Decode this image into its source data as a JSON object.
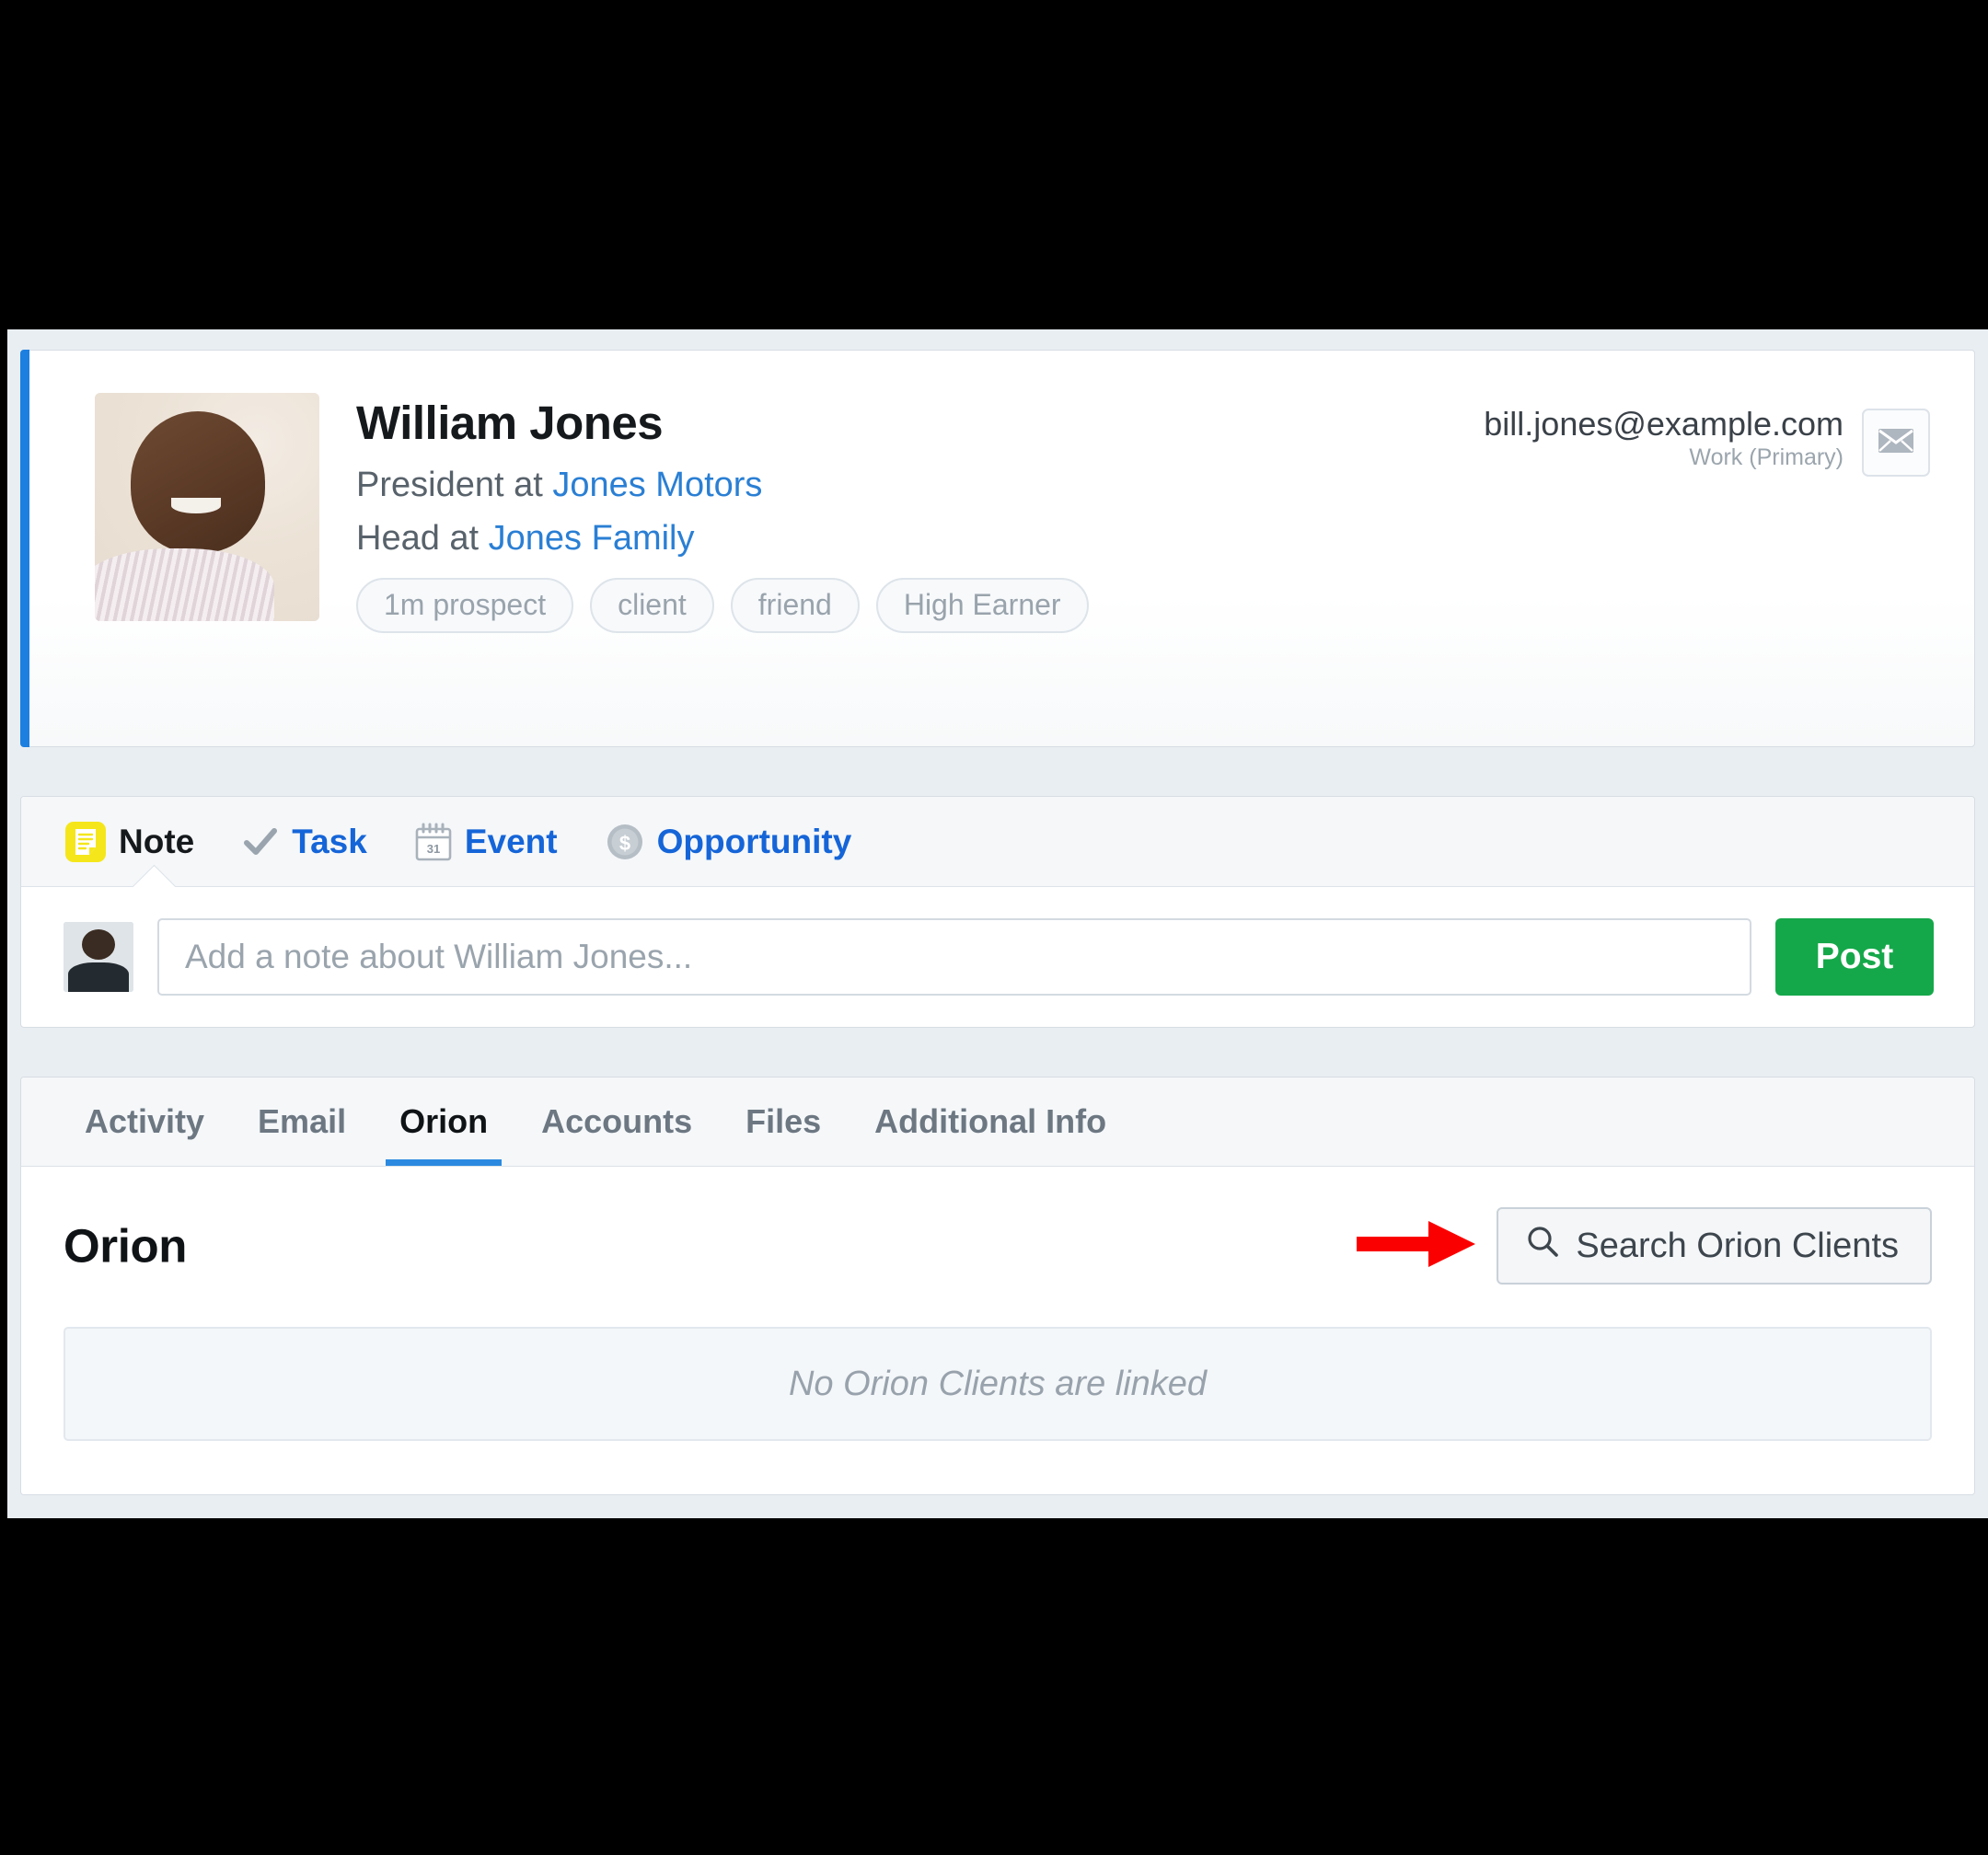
{
  "contact": {
    "name": "William Jones",
    "roles": [
      {
        "prefix": "President at ",
        "org": "Jones Motors"
      },
      {
        "prefix": "Head at ",
        "org": "Jones Family"
      }
    ],
    "tags": [
      "1m prospect",
      "client",
      "friend",
      "High Earner"
    ],
    "email": {
      "address": "bill.jones@example.com",
      "label": "Work (Primary)",
      "button_icon": "envelope-icon"
    },
    "avatar_icon": "contact-photo",
    "accent_color": "#1d7fe0"
  },
  "composer": {
    "tabs": [
      {
        "label": "Note",
        "icon": "note-icon",
        "active": true
      },
      {
        "label": "Task",
        "icon": "check-icon",
        "active": false
      },
      {
        "label": "Event",
        "icon": "calendar-icon",
        "active": false
      },
      {
        "label": "Opportunity",
        "icon": "dollar-circle-icon",
        "active": false
      }
    ],
    "note_placeholder": "Add a note about William Jones...",
    "note_value": "",
    "post_label": "Post",
    "post_color": "#15a84a",
    "user_avatar_icon": "user-avatar"
  },
  "detail": {
    "tabs": [
      {
        "label": "Activity",
        "active": false
      },
      {
        "label": "Email",
        "active": false
      },
      {
        "label": "Orion",
        "active": true
      },
      {
        "label": "Accounts",
        "active": false
      },
      {
        "label": "Files",
        "active": false
      },
      {
        "label": "Additional Info",
        "active": false
      }
    ],
    "panel_title": "Orion",
    "search_button": {
      "label": "Search Orion Clients",
      "icon": "search-icon"
    },
    "empty_message": "No Orion Clients are linked",
    "annotation_arrow_color": "#fb0000"
  }
}
